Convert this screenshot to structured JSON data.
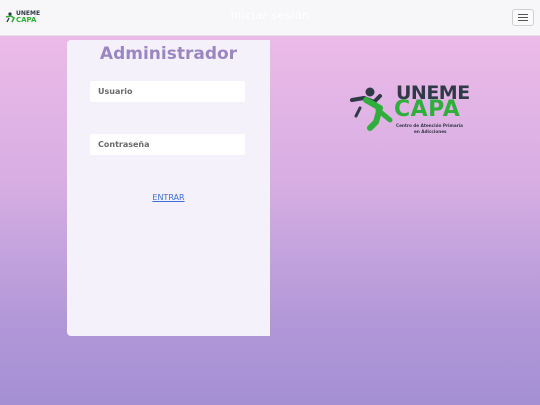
{
  "navbar": {
    "logo_top": "UNEME",
    "logo_bottom": "CAPA",
    "title": "Iniciar sesión",
    "menu_icon": "hamburger-menu-icon"
  },
  "login": {
    "title": "Administrador",
    "username_placeholder": "Usuario",
    "password_placeholder": "Contraseña",
    "submit_label": "ENTRAR"
  },
  "brand": {
    "line1": "UNEME",
    "line2": "CAPA",
    "subtitle_line1": "Centro de Atención Primaria",
    "subtitle_line2": "en Adicciones",
    "figure_icon": "leaping-person-icon"
  },
  "colors": {
    "accent_purple": "#9b86c2",
    "brand_green": "#2fae3c",
    "brand_dark": "#2f3a46",
    "link_blue": "#3a6fd6"
  }
}
